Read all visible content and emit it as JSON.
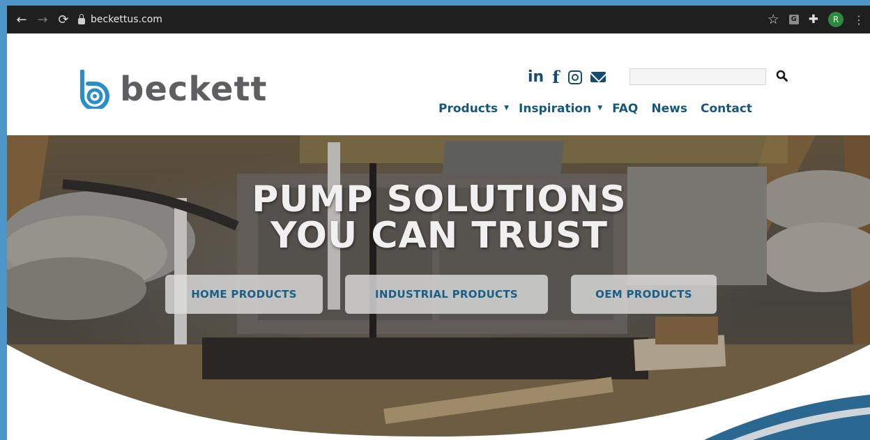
{
  "browser": {
    "url": "beckettus.com",
    "avatar_letter": "R",
    "ext_letter": "G"
  },
  "site": {
    "brand": "beckett",
    "brand_color": "#2a8fc7",
    "text_color": "#15577e",
    "search": {
      "value": "",
      "placeholder": ""
    },
    "nav": [
      {
        "label": "Products",
        "has_menu": true
      },
      {
        "label": "Inspiration",
        "has_menu": true
      },
      {
        "label": "FAQ",
        "has_menu": false
      },
      {
        "label": "News",
        "has_menu": false
      },
      {
        "label": "Contact",
        "has_menu": false
      }
    ],
    "social": [
      "linkedin-icon",
      "facebook-icon",
      "instagram-icon",
      "mail-icon"
    ]
  },
  "hero": {
    "headline_line1": "PUMP SOLUTIONS",
    "headline_line2": "YOU CAN TRUST",
    "buttons": {
      "home": "HOME PRODUCTS",
      "industrial": "INDUSTRIAL PRODUCTS",
      "oem": "OEM PRODUCTS"
    }
  }
}
